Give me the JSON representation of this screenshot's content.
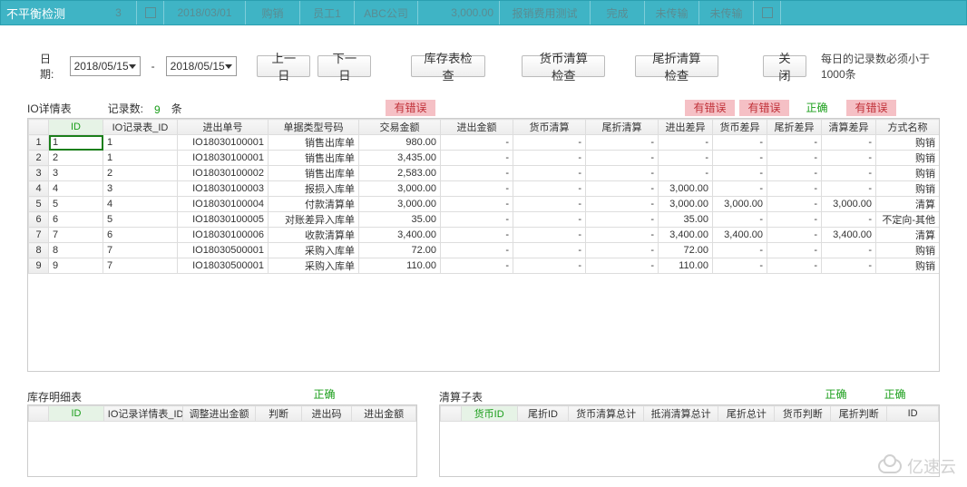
{
  "window_title": "不平衡检测",
  "bg_row": {
    "c0": "3",
    "c1": "2018/03/01",
    "c2": "购销",
    "c3": "员工1",
    "c4": "ABC公司",
    "c5": "3,000.00",
    "c6": "报销费用测试",
    "c7": "完成",
    "c8": "未传输",
    "c9": "未传输"
  },
  "toolbar": {
    "date_label": "日期:",
    "date_from": "2018/05/15",
    "date_to": "2018/05/15",
    "prev_day": "上一日",
    "next_day": "下一日",
    "btn_stock": "库存表检查",
    "btn_currency": "货币清算检查",
    "btn_tail": "尾折清算检查",
    "btn_close": "关闭",
    "note": "每日的记录数必须小于1000条"
  },
  "io_section": {
    "title": "IO详情表",
    "count_label": "记录数:",
    "count_value": "9",
    "count_unit": "条"
  },
  "status_badges": {
    "col_amount": "有错误",
    "col_indiff": "有错误",
    "col_curdiff": "有错误",
    "col_taildiff": "正确",
    "col_settlediff": "有错误"
  },
  "io_headers": {
    "id": "ID",
    "io_rec_id": "IO记录表_ID",
    "io_no": "进出单号",
    "doc_type": "单据类型号码",
    "txn_amt": "交易金额",
    "in_amt": "进出金额",
    "cur_settle": "货币清算",
    "tail_settle": "尾折清算",
    "in_diff": "进出差异",
    "cur_diff": "货币差异",
    "tail_diff": "尾折差异",
    "settle_diff": "清算差异",
    "method": "方式名称"
  },
  "io_rows": [
    {
      "n": "1",
      "id": "1",
      "rec": "1",
      "no": "IO18030100001",
      "type": "销售出库单",
      "amt": "980.00",
      "in": "-",
      "cur": "-",
      "tail": "-",
      "idf": "-",
      "cdf": "-",
      "tdf": "-",
      "sdf": "-",
      "m": "购销"
    },
    {
      "n": "2",
      "id": "2",
      "rec": "1",
      "no": "IO18030100001",
      "type": "销售出库单",
      "amt": "3,435.00",
      "in": "-",
      "cur": "-",
      "tail": "-",
      "idf": "-",
      "cdf": "-",
      "tdf": "-",
      "sdf": "-",
      "m": "购销"
    },
    {
      "n": "3",
      "id": "3",
      "rec": "2",
      "no": "IO18030100002",
      "type": "销售出库单",
      "amt": "2,583.00",
      "in": "-",
      "cur": "-",
      "tail": "-",
      "idf": "-",
      "cdf": "-",
      "tdf": "-",
      "sdf": "-",
      "m": "购销"
    },
    {
      "n": "4",
      "id": "4",
      "rec": "3",
      "no": "IO18030100003",
      "type": "报损入库单",
      "amt": "3,000.00",
      "in": "-",
      "cur": "-",
      "tail": "-",
      "idf": "3,000.00",
      "cdf": "-",
      "tdf": "-",
      "sdf": "-",
      "m": "购销"
    },
    {
      "n": "5",
      "id": "5",
      "rec": "4",
      "no": "IO18030100004",
      "type": "付款清算单",
      "amt": "3,000.00",
      "in": "-",
      "cur": "-",
      "tail": "-",
      "idf": "3,000.00",
      "cdf": "3,000.00",
      "tdf": "-",
      "sdf": "3,000.00",
      "m": "清算"
    },
    {
      "n": "6",
      "id": "6",
      "rec": "5",
      "no": "IO18030100005",
      "type": "对账差异入库单",
      "amt": "35.00",
      "in": "-",
      "cur": "-",
      "tail": "-",
      "idf": "35.00",
      "cdf": "-",
      "tdf": "-",
      "sdf": "-",
      "m": "不定向-其他"
    },
    {
      "n": "7",
      "id": "7",
      "rec": "6",
      "no": "IO18030100006",
      "type": "收款清算单",
      "amt": "3,400.00",
      "in": "-",
      "cur": "-",
      "tail": "-",
      "idf": "3,400.00",
      "cdf": "3,400.00",
      "tdf": "-",
      "sdf": "3,400.00",
      "m": "清算"
    },
    {
      "n": "8",
      "id": "8",
      "rec": "7",
      "no": "IO18030500001",
      "type": "采购入库单",
      "amt": "72.00",
      "in": "-",
      "cur": "-",
      "tail": "-",
      "idf": "72.00",
      "cdf": "-",
      "tdf": "-",
      "sdf": "-",
      "m": "购销"
    },
    {
      "n": "9",
      "id": "9",
      "rec": "7",
      "no": "IO18030500001",
      "type": "采购入库单",
      "amt": "110.00",
      "in": "-",
      "cur": "-",
      "tail": "-",
      "idf": "110.00",
      "cdf": "-",
      "tdf": "-",
      "sdf": "-",
      "m": "购销"
    }
  ],
  "stock_section": {
    "title": "库存明细表",
    "status": "正确",
    "headers": {
      "id": "ID",
      "detail_id": "IO记录详情表_ID",
      "adj_amt": "调整进出金额",
      "judge": "判断",
      "code": "进出码",
      "in_amt": "进出金额"
    }
  },
  "settle_section": {
    "title": "清算子表",
    "status1": "正确",
    "status2": "正确",
    "headers": {
      "cur_id": "货币ID",
      "tail_id": "尾折ID",
      "cur_total": "货币清算总计",
      "offset_total": "抵消清算总计",
      "tail_total": "尾折总计",
      "cur_judge": "货币判断",
      "tail_judge": "尾折判断",
      "id": "ID"
    }
  },
  "watermark": "亿速云"
}
